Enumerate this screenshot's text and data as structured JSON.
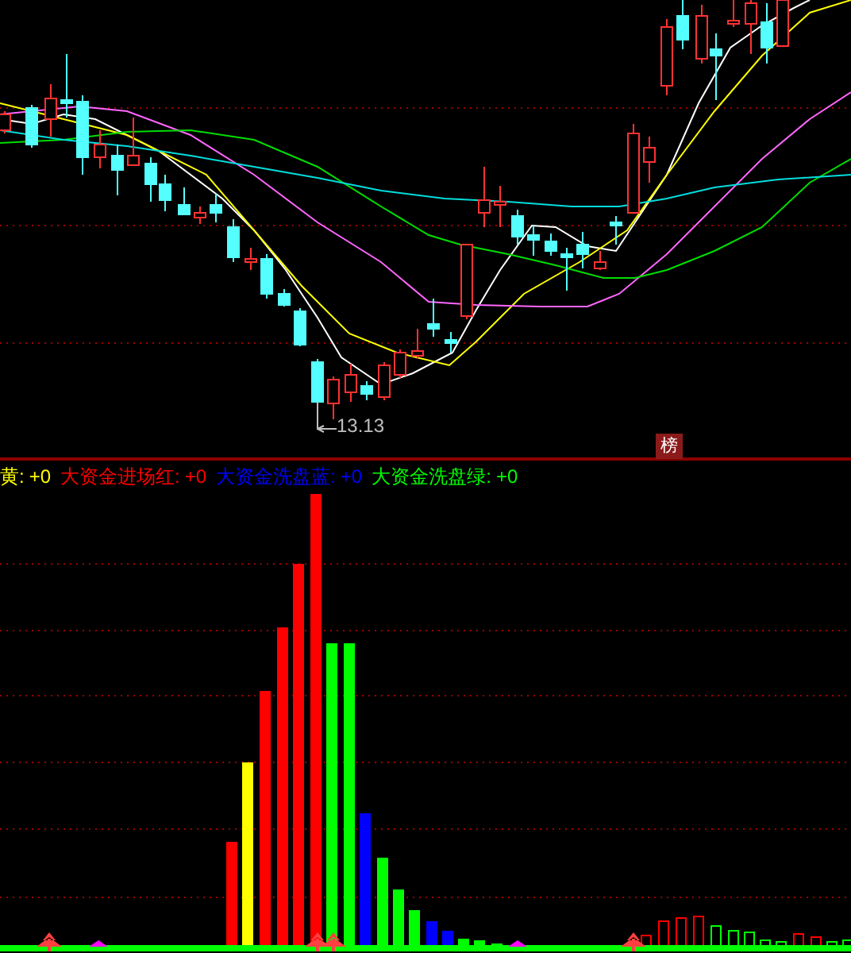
{
  "price_panel": {
    "low_label": "13.13",
    "badge": "榜"
  },
  "indicator_legend": [
    {
      "name": "黄:",
      "value": "+0",
      "color": "#ffff00"
    },
    {
      "name": "大资金进场红:",
      "value": "+0",
      "color": "#ff0000"
    },
    {
      "name": "大资金洗盘蓝:",
      "value": "+0",
      "color": "#0000ff"
    },
    {
      "name": "大资金洗盘绿:",
      "value": "+0",
      "color": "#00ff00"
    }
  ]
}
